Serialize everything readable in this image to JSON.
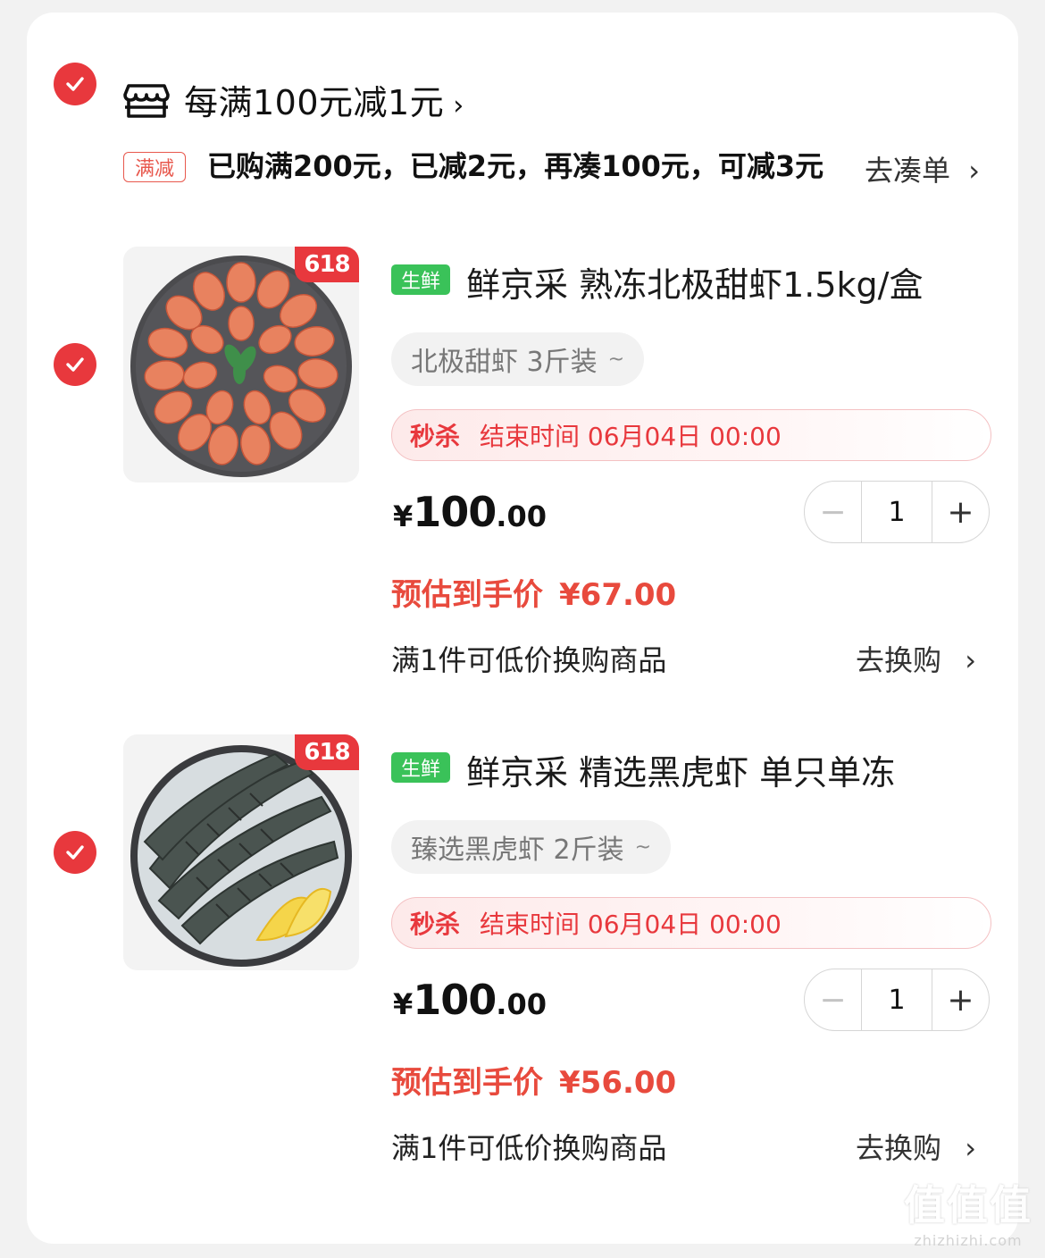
{
  "store": {
    "title": "每满100元减1元",
    "chevron": "›"
  },
  "promo": {
    "tag": "满减",
    "text": "已购满200元，已减2元，再凑100元，可减3元",
    "link": "去凑单",
    "link_chevron": "›"
  },
  "items": [
    {
      "badge": "618",
      "tag": "生鲜",
      "title": "鲜京采 熟冻北极甜虾1.5kg/盒",
      "spec": "北极甜虾 3斤装",
      "spec_chevron": "~",
      "flash_label": "秒杀",
      "flash_time": "结束时间 06月04日 00:00",
      "price_currency": "¥",
      "price_int": "100",
      "price_dec": ".00",
      "quantity": "1",
      "minus": "−",
      "plus": "+",
      "est_label": "预估到手价",
      "est_value": "¥67.00",
      "swap_text": "满1件可低价换购商品",
      "swap_link": "去换购",
      "swap_chevron": "›"
    },
    {
      "badge": "618",
      "tag": "生鲜",
      "title": "鲜京采 精选黑虎虾 单只单冻",
      "spec": "臻选黑虎虾 2斤装",
      "spec_chevron": "~",
      "flash_label": "秒杀",
      "flash_time": "结束时间 06月04日 00:00",
      "price_currency": "¥",
      "price_int": "100",
      "price_dec": ".00",
      "quantity": "1",
      "minus": "−",
      "plus": "+",
      "est_label": "预估到手价",
      "est_value": "¥56.00",
      "swap_text": "满1件可低价换购商品",
      "swap_link": "去换购",
      "swap_chevron": "›"
    }
  ],
  "watermark": {
    "big": "值值值",
    "small": "zhizhizhi.com"
  },
  "colors": {
    "accent": "#e8383d",
    "fresh": "#3ac259",
    "estimate": "#e84a3d"
  }
}
